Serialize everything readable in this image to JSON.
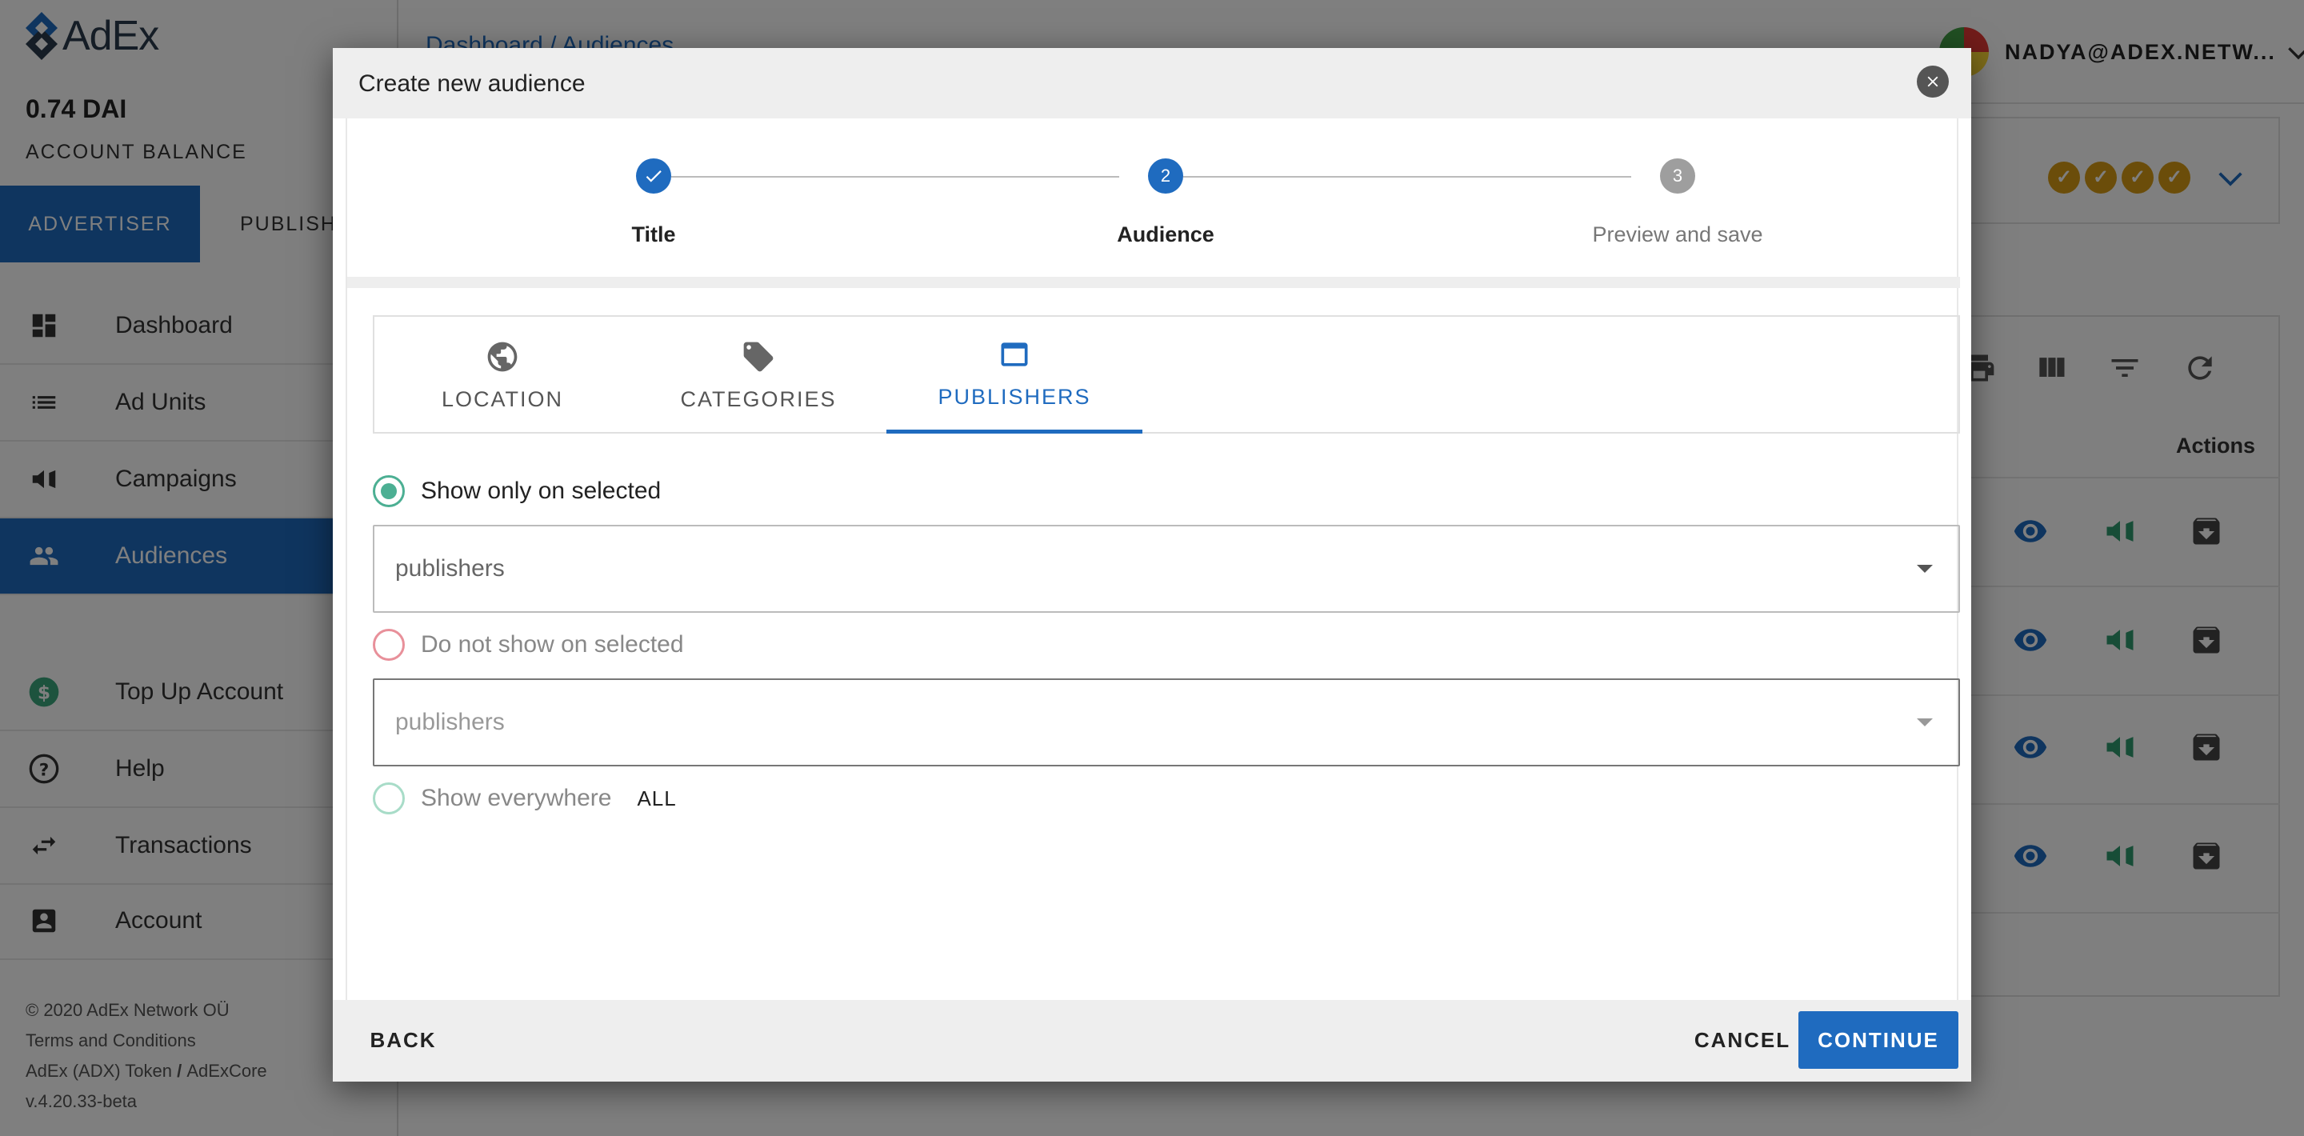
{
  "app": {
    "brand": "AdEx"
  },
  "account": {
    "balance": "0.74 DAI",
    "balance_label": "ACCOUNT BALANCE"
  },
  "roles": {
    "advertiser": "ADVERTISER",
    "publisher": "PUBLISH"
  },
  "nav": {
    "dashboard": "Dashboard",
    "ad_units": "Ad Units",
    "campaigns": "Campaigns",
    "audiences": "Audiences",
    "top_up": "Top Up Account",
    "help": "Help",
    "transactions": "Transactions",
    "account": "Account"
  },
  "footer": {
    "copyright": "© 2020  AdEx Network OÜ",
    "terms": "Terms and Conditions",
    "token": "AdEx (ADX) Token",
    "sep": " / ",
    "core": "AdExCore",
    "version": "v.4.20.33-beta"
  },
  "header": {
    "breadcrumb": "Dashboard  /  Audiences",
    "user": "NADYA@ADEX.NETW..."
  },
  "table": {
    "actions_header": "Actions"
  },
  "modal": {
    "title": "Create new audience",
    "steps": [
      {
        "number": "",
        "label": "Title",
        "state": "done"
      },
      {
        "number": "2",
        "label": "Audience",
        "state": "active"
      },
      {
        "number": "3",
        "label": "Preview and save",
        "state": "pending"
      }
    ],
    "tabs": [
      {
        "label": "LOCATION",
        "icon": "globe-icon"
      },
      {
        "label": "CATEGORIES",
        "icon": "tag-icon"
      },
      {
        "label": "PUBLISHERS",
        "icon": "window-icon",
        "active": true
      }
    ],
    "options": {
      "show_only": "Show only on selected",
      "show_only_select": "publishers",
      "do_not_show": "Do not show on selected",
      "do_not_show_select": "publishers",
      "show_everywhere": "Show everywhere",
      "show_everywhere_value": "ALL"
    },
    "footer": {
      "back": "BACK",
      "cancel": "CANCEL",
      "continue": "CONTINUE"
    }
  },
  "colors": {
    "primary": "#1f6bbf",
    "success": "#4caf93",
    "error": "#e57373",
    "gold": "#d69b14"
  }
}
